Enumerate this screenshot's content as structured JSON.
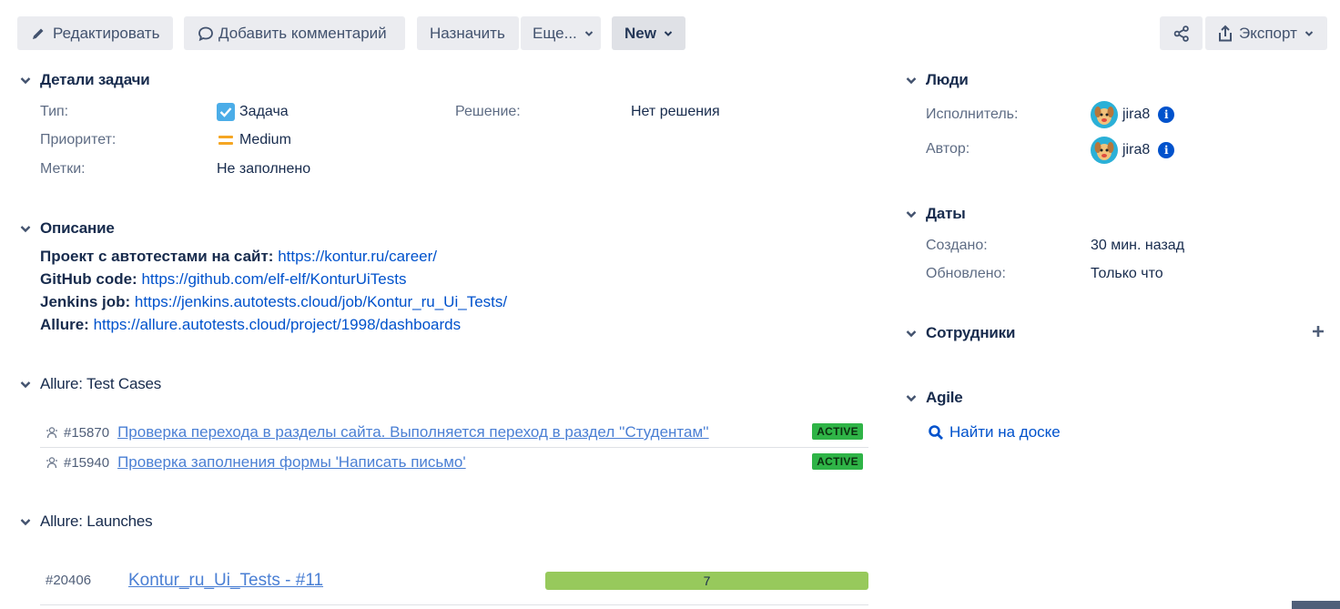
{
  "toolbar": {
    "edit_label": "Редактировать",
    "comment_label": "Добавить комментарий",
    "assign_label": "Назначить",
    "more_label": "Еще...",
    "status_label": "New",
    "export_label": "Экспорт"
  },
  "details": {
    "title": "Детали задачи",
    "type_label": "Тип:",
    "type_value": "Задача",
    "priority_label": "Приоритет:",
    "priority_value": "Medium",
    "labels_label": "Метки:",
    "labels_value": "Не заполнено",
    "resolution_label": "Решение:",
    "resolution_value": "Нет решения"
  },
  "description": {
    "title": "Описание",
    "lines": [
      {
        "key": "Проект с автотестами на сайт:",
        "link": "https://kontur.ru/career/"
      },
      {
        "key": "GitHub code:",
        "link": "https://github.com/elf-elf/KonturUiTests"
      },
      {
        "key": "Jenkins job:",
        "link": "https://jenkins.autotests.cloud/job/Kontur_ru_Ui_Tests/"
      },
      {
        "key": "Allure:",
        "link": "https://allure.autotests.cloud/project/1998/dashboards"
      }
    ]
  },
  "test_cases": {
    "title": "Allure: Test Cases",
    "items": [
      {
        "id": "#15870",
        "name": "Проверка перехода в разделы сайта. Выполняется переход в раздел ''Студентам''",
        "status": "ACTIVE"
      },
      {
        "id": "#15940",
        "name": "Проверка заполнения формы 'Написать письмо'",
        "status": "ACTIVE"
      }
    ]
  },
  "launches": {
    "title": "Allure: Launches",
    "items": [
      {
        "id": "#20406",
        "name": "Kontur_ru_Ui_Tests - #11",
        "passed": 7
      }
    ]
  },
  "people": {
    "title": "Люди",
    "assignee_label": "Исполнитель:",
    "assignee_value": "jira8",
    "reporter_label": "Автор:",
    "reporter_value": "jira8"
  },
  "dates": {
    "title": "Даты",
    "created_label": "Создано:",
    "created_value": "30 мин. назад",
    "updated_label": "Обновлено:",
    "updated_value": "Только что"
  },
  "staff": {
    "title": "Сотрудники"
  },
  "agile": {
    "title": "Agile",
    "find_label": "Найти на доске"
  },
  "colors": {
    "link": "#0052cc",
    "badge_active": "#2fb447",
    "launch_bar": "#97c95c",
    "info": "#0052cc",
    "avatar_bg": "#2bb0d7",
    "priority": "#f5a623"
  }
}
